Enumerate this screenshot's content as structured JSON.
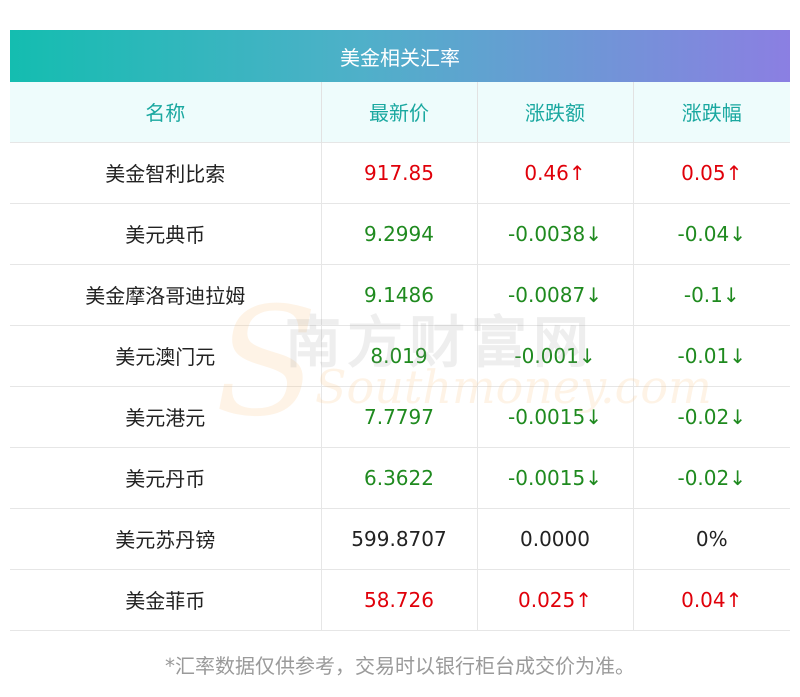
{
  "title": "美金相关汇率",
  "headers": {
    "name": "名称",
    "latest": "最新价",
    "change": "涨跌额",
    "change_pct": "涨跌幅"
  },
  "rows": [
    {
      "name": "美金智利比索",
      "latest": "917.85",
      "change": "0.46↑",
      "change_pct": "0.05↑",
      "trend": "up"
    },
    {
      "name": "美元典币",
      "latest": "9.2994",
      "change": "-0.0038↓",
      "change_pct": "-0.04↓",
      "trend": "down"
    },
    {
      "name": "美金摩洛哥迪拉姆",
      "latest": "9.1486",
      "change": "-0.0087↓",
      "change_pct": "-0.1↓",
      "trend": "down"
    },
    {
      "name": "美元澳门元",
      "latest": "8.019",
      "change": "-0.001↓",
      "change_pct": "-0.01↓",
      "trend": "down"
    },
    {
      "name": "美元港元",
      "latest": "7.7797",
      "change": "-0.0015↓",
      "change_pct": "-0.02↓",
      "trend": "down"
    },
    {
      "name": "美元丹币",
      "latest": "6.3622",
      "change": "-0.0015↓",
      "change_pct": "-0.02↓",
      "trend": "down"
    },
    {
      "name": "美元苏丹镑",
      "latest": "599.8707",
      "change": "0.0000",
      "change_pct": "0%",
      "trend": "flat"
    },
    {
      "name": "美金菲币",
      "latest": "58.726",
      "change": "0.025↑",
      "change_pct": "0.04↑",
      "trend": "up"
    }
  ],
  "watermark": {
    "cn": "南方财富网",
    "en": "Southmoney.com"
  },
  "footnote": "*汇率数据仅供参考，交易时以银行柜台成交价为准。",
  "colors": {
    "up": "#e0000a",
    "down": "#1f8a1f",
    "header_text": "#1aa8a0",
    "title_gradient_start": "#14bdb0",
    "title_gradient_end": "#8b7fe2"
  }
}
